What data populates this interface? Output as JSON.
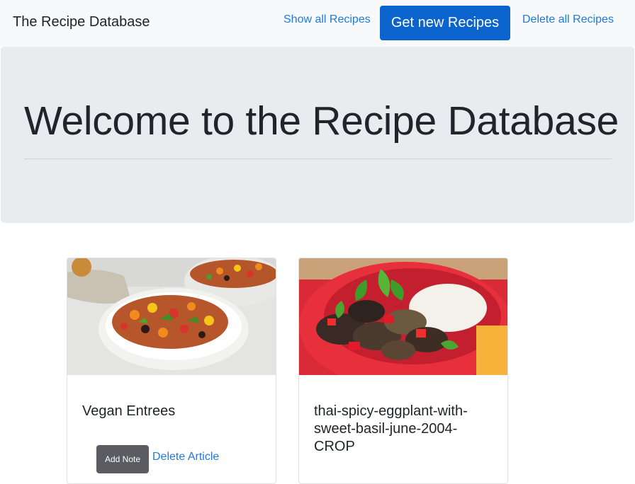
{
  "navbar": {
    "brand": "The Recipe Database",
    "show_all_label": "Show all Recipes",
    "get_new_label": "Get new Recipes",
    "delete_all_label": "Delete all Recipes"
  },
  "jumbotron": {
    "title": "Welcome to the Recipe Database"
  },
  "cards": [
    {
      "title": "Vegan Entrees",
      "image_icon": "vegetable-bowl-photo",
      "add_note_label": "Add Note",
      "delete_label": "Delete Article"
    },
    {
      "title": "thai-spicy-eggplant-with-sweet-basil-june-2004-CROP",
      "image_icon": "eggplant-dish-photo"
    }
  ],
  "colors": {
    "primary": "#0b63ce",
    "link": "#1f7ad9",
    "navbar_bg": "#f8f9fa",
    "jumbotron_bg": "#e9ecef",
    "note_button": "#5a5c62"
  }
}
